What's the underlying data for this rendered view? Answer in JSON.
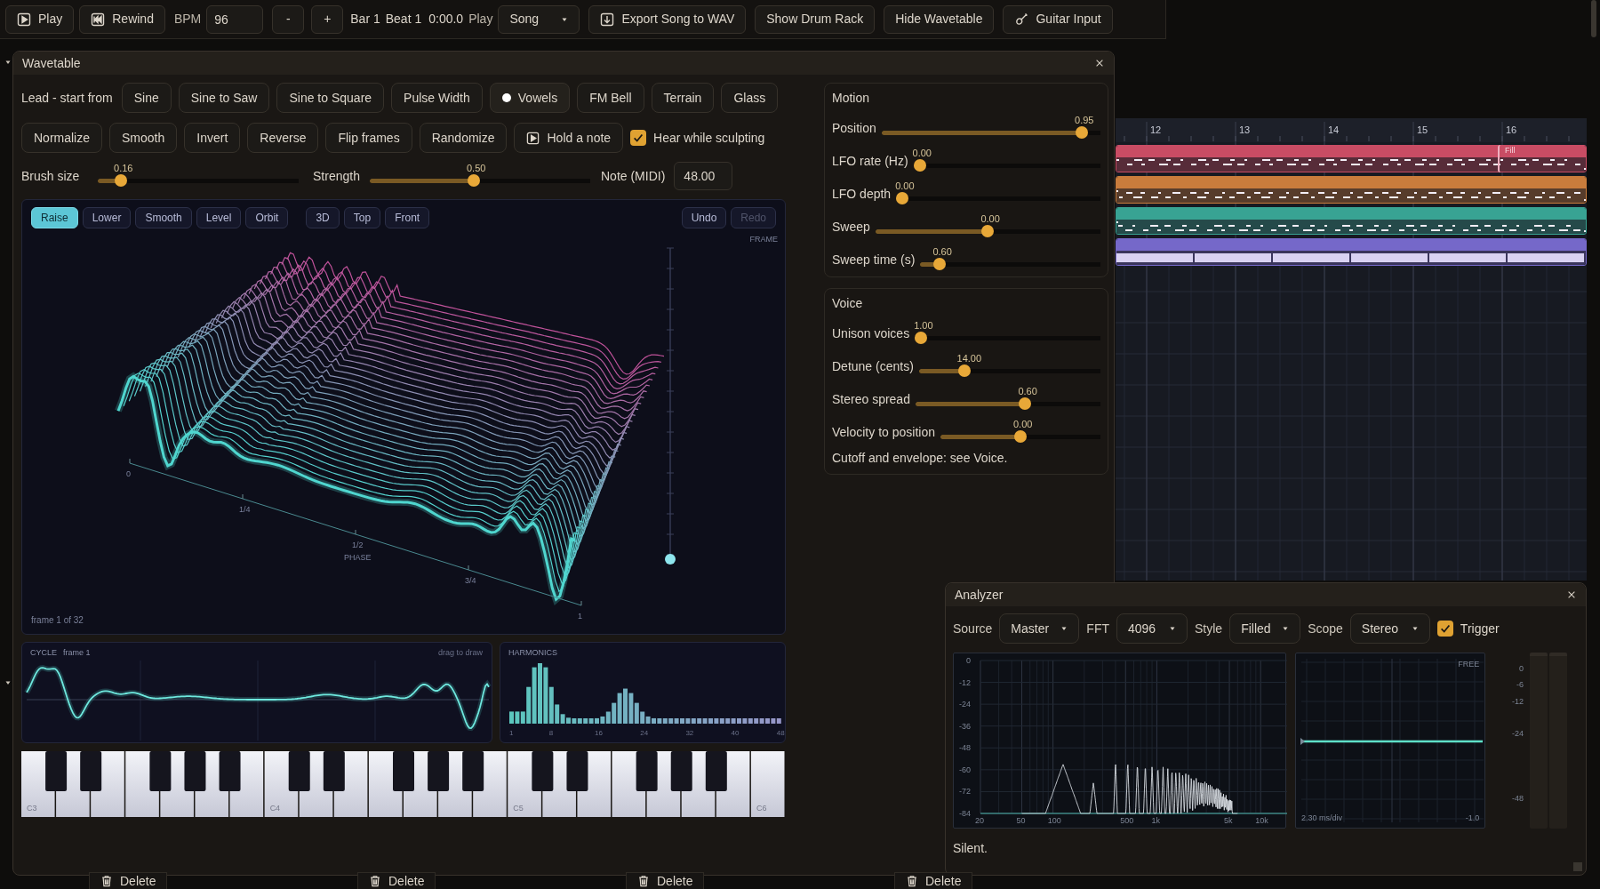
{
  "top_bar": {
    "play": "Play",
    "rewind": "Rewind",
    "bpm_label": "BPM",
    "bpm_value": "96",
    "minus": "-",
    "plus": "+",
    "bar": "Bar 1",
    "beat": "Beat 1",
    "time": "0:00.0",
    "mode_label": "Play",
    "mode_select": "Song",
    "buttons": [
      {
        "kind": "export",
        "label": "Export Song to WAV"
      },
      {
        "kind": "plain",
        "label": "Show Drum Rack"
      },
      {
        "kind": "plain",
        "label": "Hide Wavetable"
      },
      {
        "kind": "guitar",
        "label": "Guitar Input"
      }
    ]
  },
  "wavetable": {
    "title": "Wavetable",
    "presets_label": "Lead - start from",
    "presets": [
      {
        "label": "Sine",
        "selected": false
      },
      {
        "label": "Sine to Saw",
        "selected": false
      },
      {
        "label": "Sine to Square",
        "selected": false
      },
      {
        "label": "Pulse Width",
        "selected": false
      },
      {
        "label": "Vowels",
        "selected": true
      },
      {
        "label": "FM Bell",
        "selected": false
      },
      {
        "label": "Terrain",
        "selected": false
      },
      {
        "label": "Glass",
        "selected": false
      }
    ],
    "tools": [
      {
        "kind": "button",
        "label": "Normalize"
      },
      {
        "kind": "button",
        "label": "Smooth"
      },
      {
        "kind": "button",
        "label": "Invert"
      },
      {
        "kind": "button",
        "label": "Reverse"
      },
      {
        "kind": "button",
        "label": "Flip frames"
      },
      {
        "kind": "button",
        "label": "Randomize"
      },
      {
        "kind": "play",
        "label": "Hold a note"
      }
    ],
    "hear_while_sculpting": {
      "label": "Hear while sculpting",
      "checked": true
    },
    "brush_size": {
      "label": "Brush size",
      "reading": "0.16",
      "level": 0.09
    },
    "strength": {
      "label": "Strength",
      "reading": "0.50",
      "level": 0.47
    },
    "note": {
      "label": "Note (MIDI)",
      "value": "48.00"
    },
    "viewport": {
      "brushes": [
        {
          "label": "Raise",
          "selected": true
        },
        {
          "label": "Lower",
          "selected": false
        },
        {
          "label": "Smooth",
          "selected": false
        },
        {
          "label": "Level",
          "selected": false
        },
        {
          "label": "Orbit",
          "selected": false
        }
      ],
      "views": [
        {
          "label": "3D",
          "selected": false
        },
        {
          "label": "Top",
          "selected": false
        },
        {
          "label": "Front",
          "selected": false
        }
      ],
      "undo": {
        "label": "Undo",
        "disabled": false
      },
      "redo": {
        "label": "Redo",
        "disabled": true
      },
      "frame_label": "FRAME",
      "frame_slider": {
        "level": 0
      },
      "frame_caption": "frame 1 of 32",
      "phase_ticks": [
        "0",
        "1/4",
        "1/2",
        "3/4",
        "1"
      ],
      "phase_label": "PHASE"
    },
    "cycle": {
      "title": "CYCLE",
      "frame": "frame 1",
      "hint": "drag to draw"
    },
    "harmonics": {
      "title": "HARMONICS",
      "ticks": [
        "1",
        "8",
        "16",
        "24",
        "32",
        "40",
        "48"
      ]
    },
    "keyboard": {
      "labels": [
        "C3",
        "C4",
        "C5",
        "C6"
      ]
    },
    "motion": {
      "title": "Motion",
      "sliders": [
        {
          "label": "Position",
          "reading": "0.95",
          "level": 0.94
        },
        {
          "label": "LFO rate (Hz)",
          "reading": "0.00",
          "level": 0
        },
        {
          "label": "LFO depth",
          "reading": "0.00",
          "level": 0
        },
        {
          "label": "Sweep",
          "reading": "0.00",
          "level": 0.5
        },
        {
          "label": "Sweep time (s)",
          "reading": "0.60",
          "level": 0.08
        }
      ]
    },
    "voice": {
      "title": "Voice",
      "sliders": [
        {
          "label": "Unison voices",
          "reading": "1.00",
          "level": 0
        },
        {
          "label": "Detune (cents)",
          "reading": "14.00",
          "level": 0.23
        },
        {
          "label": "Stereo spread",
          "reading": "0.60",
          "level": 0.6
        },
        {
          "label": "Velocity to position",
          "reading": "0.00",
          "level": 0.5
        }
      ],
      "note": "Cutoff and envelope: see Voice."
    }
  },
  "arrangement": {
    "bars": [
      "12",
      "13",
      "14",
      "15",
      "16"
    ],
    "tracks": [
      {
        "color": "#c94c64",
        "fill_clip": {
          "label": "Fill"
        }
      },
      {
        "color": "#c97c3c"
      },
      {
        "color": "#38a393"
      },
      {
        "color": "#7568c9"
      }
    ]
  },
  "analyzer": {
    "title": "Analyzer",
    "controls": [
      {
        "label": "Source",
        "value": "Master"
      },
      {
        "label": "FFT",
        "value": "4096"
      },
      {
        "label": "Style",
        "value": "Filled"
      },
      {
        "label": "Scope",
        "value": "Stereo"
      }
    ],
    "trigger": {
      "label": "Trigger",
      "checked": true
    },
    "spectrum": {
      "y_ticks": [
        "0",
        "-12",
        "-24",
        "-36",
        "-48",
        "-60",
        "-72",
        "-84"
      ],
      "x_ticks": [
        "20",
        "50",
        "100",
        "500",
        "1k",
        "5k",
        "10k"
      ]
    },
    "scope": {
      "mode": "FREE",
      "time_div": "2.30 ms/div",
      "scale": "-1.0"
    },
    "meter_ticks": [
      "0",
      "-6",
      "-12",
      "-24",
      "-48"
    ],
    "status": "Silent."
  },
  "track_rows": [
    {
      "delete": "Delete"
    },
    {
      "delete": "Delete"
    },
    {
      "delete": "Delete"
    },
    {
      "delete": "Delete"
    }
  ]
}
